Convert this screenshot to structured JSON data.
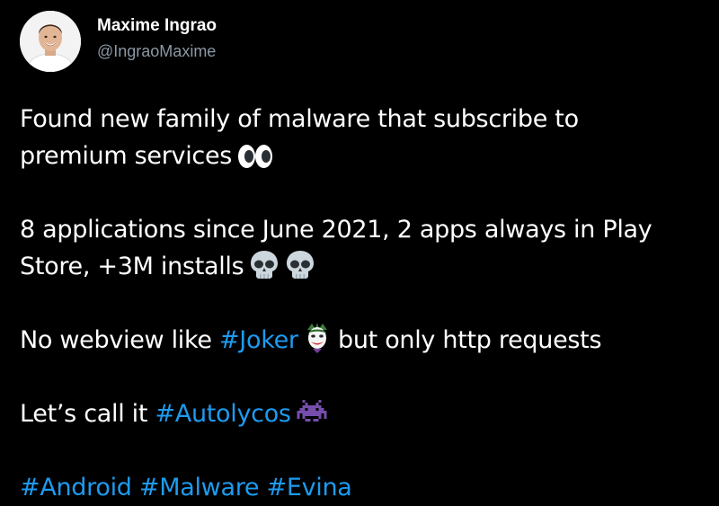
{
  "author": {
    "display_name": "Maxime Ingrao",
    "handle": "@IngraoMaxime"
  },
  "tweet": {
    "p1": {
      "line1": "Found new family of malware that subscribe to",
      "line2": "premium services",
      "emoji": "eyes-emoji"
    },
    "p2": {
      "line1": "8 applications since June 2021, 2 apps always in Play",
      "line2": "Store, +3M installs",
      "emoji": "skull-emoji"
    },
    "p3": {
      "before": "No webview like",
      "hashtag": "#Joker",
      "after": "but only http requests",
      "emoji": "joker-emoji"
    },
    "p4": {
      "before": "Let’s call it",
      "hashtag": "#Autolycos",
      "emoji": "space-invader-emoji"
    },
    "p5": {
      "hashtags": [
        "#Android",
        "#Malware",
        "#Evina"
      ]
    }
  },
  "colors": {
    "background": "#000000",
    "text": "#ffffff",
    "handle": "#8b98a5",
    "hashtag": "#1d9bf0"
  }
}
